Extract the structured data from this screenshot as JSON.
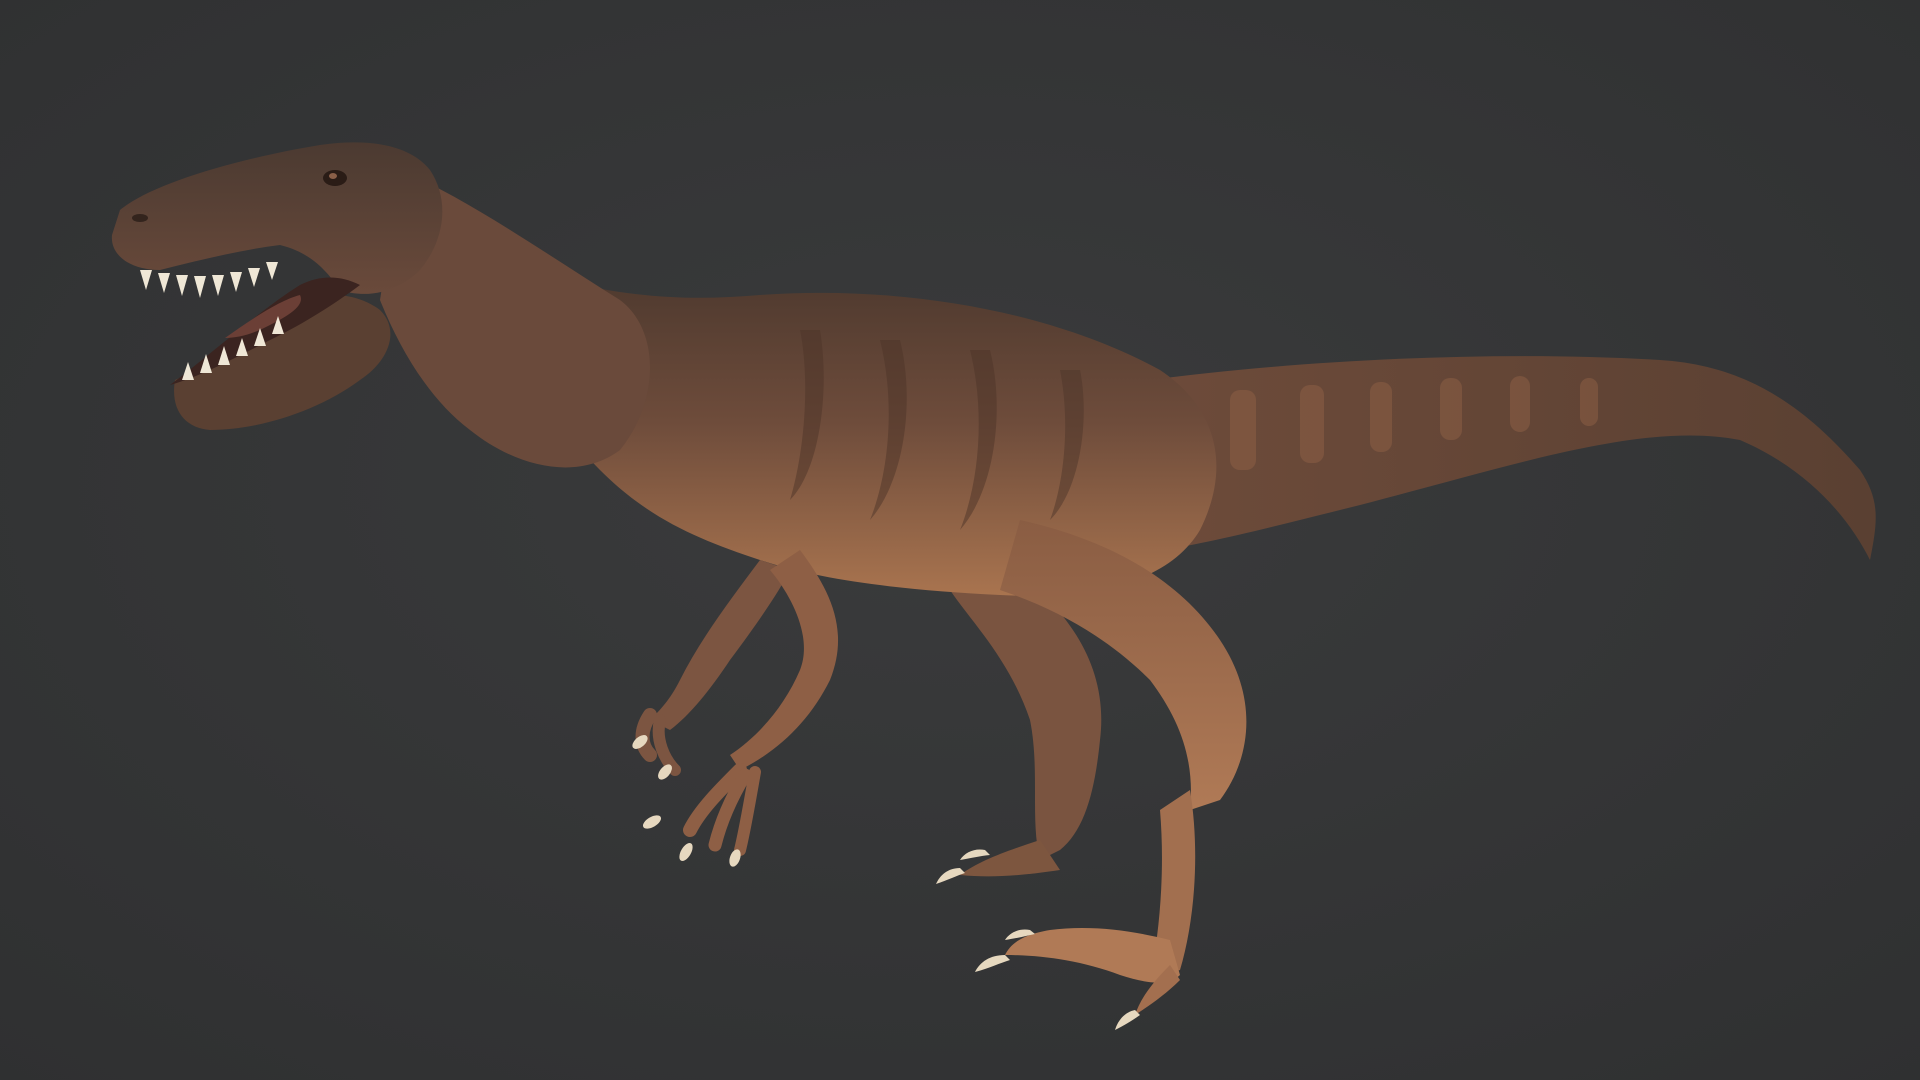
{
  "scene": {
    "subject_icon": "theropod-dinosaur-model",
    "colors": {
      "background": "#3a3b3c",
      "background_vignette": "#2f3031",
      "skin_dark": "#4a352b",
      "skin_mid": "#7a5440",
      "skin_light": "#b07a55",
      "belly": "#c08b5e",
      "stripe": "#5a3e30",
      "claw": "#e6d8bf",
      "tooth": "#efe7d6",
      "mouth": "#3b2420"
    }
  }
}
